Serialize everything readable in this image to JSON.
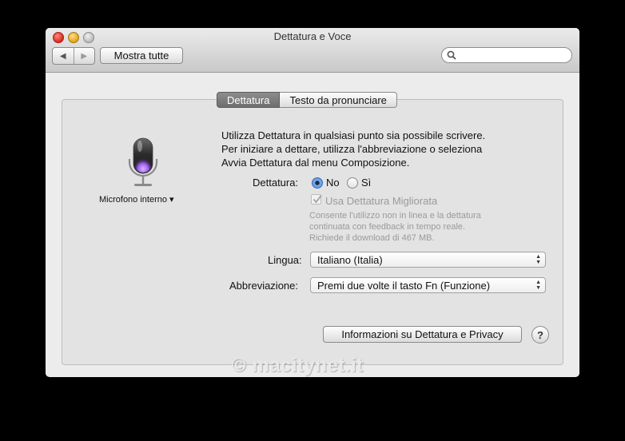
{
  "window": {
    "title": "Dettatura e Voce"
  },
  "toolbar": {
    "back_icon": "◀",
    "forward_icon": "▶",
    "show_all_label": "Mostra tutte",
    "search_placeholder": ""
  },
  "tabs": [
    {
      "label": "Dettatura",
      "selected": true
    },
    {
      "label": "Testo da pronunciare",
      "selected": false
    }
  ],
  "microphone": {
    "label": "Microfono interno ▾"
  },
  "description": [
    "Utilizza Dettatura in qualsiasi punto sia possibile scrivere.",
    "Per iniziare a dettare, utilizza l'abbreviazione o seleziona",
    "Avvia Dettatura dal menu Composizione."
  ],
  "dictation": {
    "label": "Dettatura:",
    "option_no": "No",
    "option_si": "Sì",
    "selected": "No"
  },
  "enhanced": {
    "label": "Usa Dettatura Migliorata",
    "checked": true,
    "enabled": false,
    "note": [
      "Consente l'utilizzo non in linea e la dettatura",
      "continuata con feedback in tempo reale.",
      "Richiede il download di 467 MB."
    ]
  },
  "language": {
    "label": "Lingua:",
    "value": "Italiano (Italia)"
  },
  "shortcut": {
    "label": "Abbreviazione:",
    "value": "Premi due volte il tasto Fn (Funzione)"
  },
  "info_button": "Informazioni su Dettatura e Privacy",
  "help_button": "?",
  "watermark": "© macitynet.it",
  "colors": {
    "selected_tab": "#7a7a7a",
    "radio_selected": "#4f87d4",
    "mic_glow": "#b07cff"
  }
}
